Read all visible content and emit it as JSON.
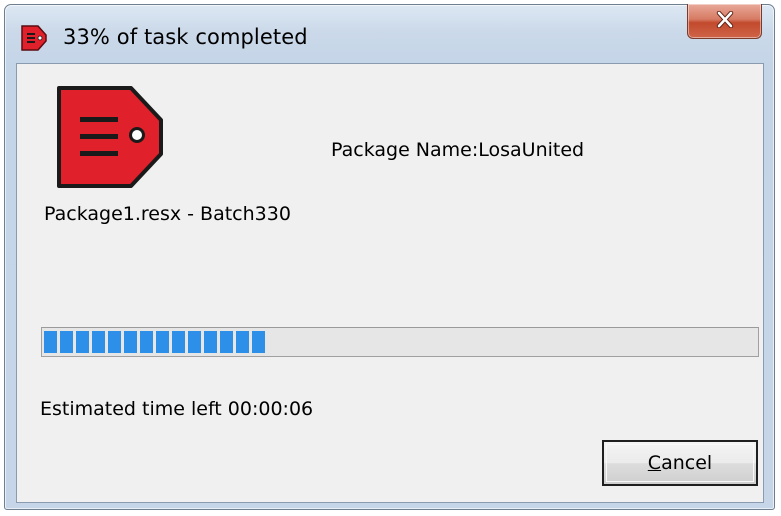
{
  "window": {
    "title": "33% of task completed",
    "close_label": "Close"
  },
  "content": {
    "file_label": "Package1.resx - Batch330",
    "package_label": "Package Name:LosaUnited",
    "progress_percent": 33,
    "eta_label": "Estimated time left 00:00:06"
  },
  "actions": {
    "cancel_mnemonic": "C",
    "cancel_rest": "ancel"
  },
  "colors": {
    "icon_red": "#e0202a",
    "progress_blue": "#2d8fe8",
    "close_red": "#c24a2d"
  },
  "icons": {
    "app": "tag-icon",
    "close": "close-icon"
  }
}
